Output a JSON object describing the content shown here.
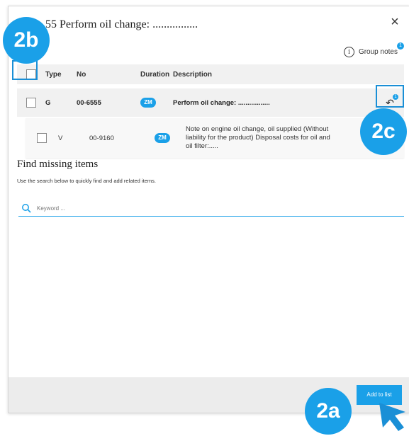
{
  "dialog": {
    "title": "55 Perform oil change: ................",
    "close_glyph": "×",
    "group_notes_label": "Group notes",
    "group_notes_count": "1"
  },
  "table": {
    "headers": [
      "Type",
      "No",
      "Duration",
      "Description"
    ],
    "rows": [
      {
        "type": "G",
        "no": "00-6555",
        "duration": "ZM",
        "description": "Perform oil change: .................",
        "notes_count": "1"
      },
      {
        "type": "V",
        "no": "00-9160",
        "duration": "ZM",
        "description": "Note on engine oil change, oil supplied (Without liability for the product) Disposal costs for oil and oil filter:....."
      }
    ]
  },
  "find_missing": {
    "title": "Find missing items",
    "subtitle": "Use the search below to quickly find and add related items.",
    "search_placeholder": "Keyword ..."
  },
  "footer": {
    "add_button_label": "Add to list"
  },
  "annotations": {
    "a": "2a",
    "b": "2b",
    "c": "2c"
  },
  "colors": {
    "accent": "#1aa0e8",
    "annotation": "#1a8fd6"
  },
  "icons": [
    "info-icon",
    "close-icon",
    "search-icon",
    "notes-arrow-icon",
    "cursor-arrow-icon"
  ]
}
